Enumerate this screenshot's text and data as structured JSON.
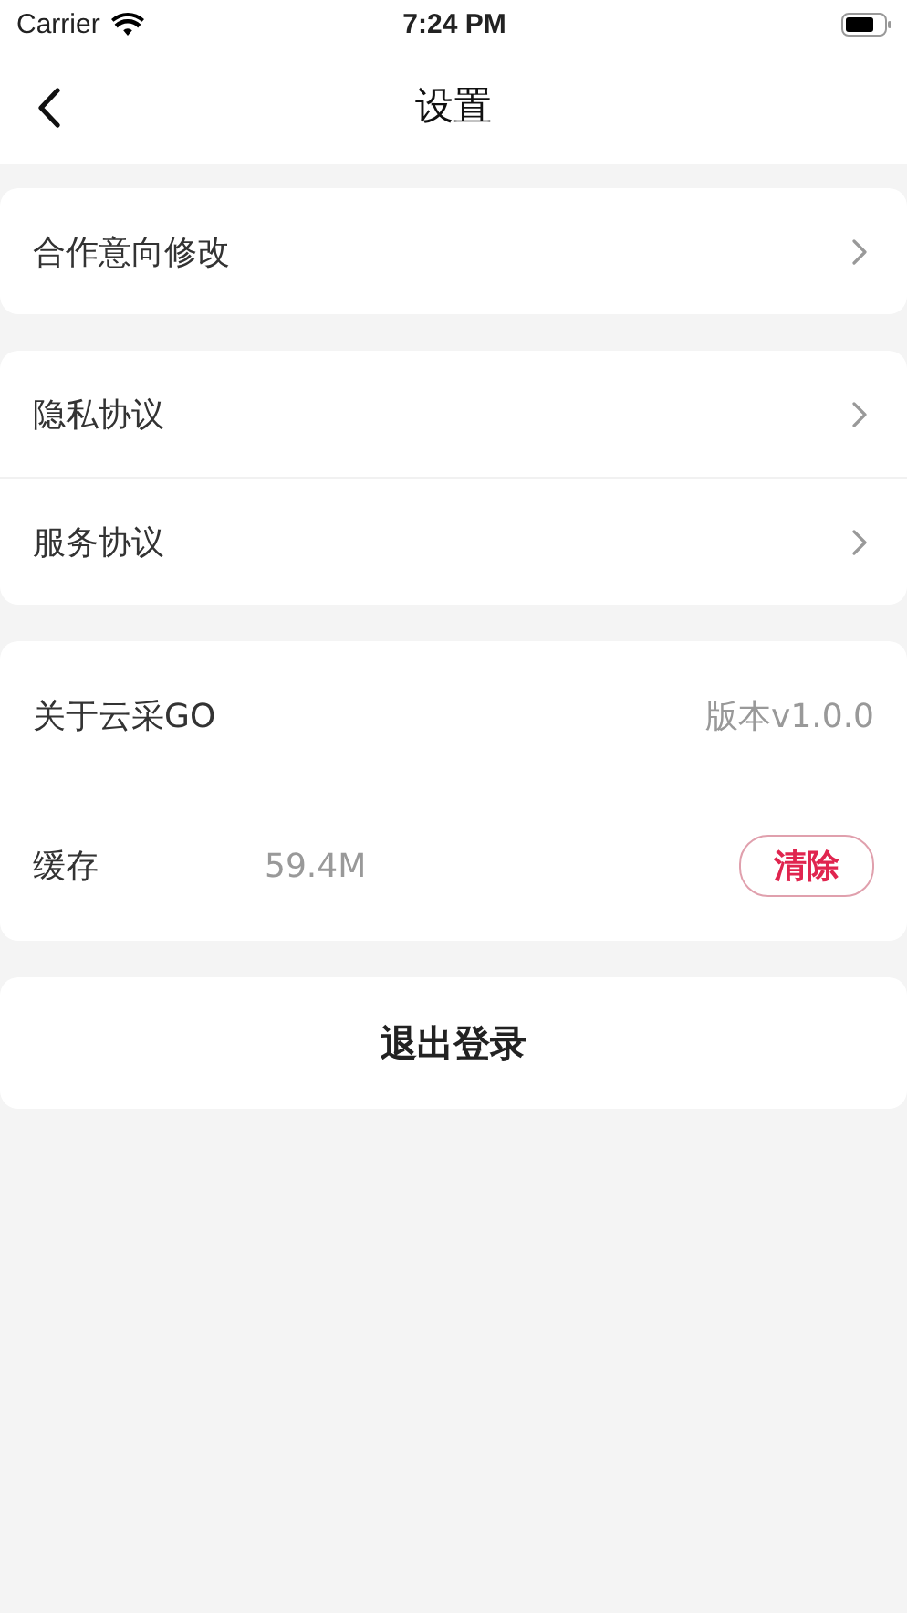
{
  "status_bar": {
    "carrier": "Carrier",
    "time": "7:24 PM"
  },
  "nav": {
    "title": "设置"
  },
  "groups": [
    {
      "rows": [
        {
          "kind": "link",
          "label": "合作意向修改"
        }
      ]
    },
    {
      "rows": [
        {
          "kind": "link",
          "label": "隐私协议"
        },
        {
          "kind": "link",
          "label": "服务协议"
        }
      ]
    },
    {
      "rows": [
        {
          "kind": "info",
          "label": "关于云采GO",
          "value": "版本v1.0.0"
        },
        {
          "kind": "cache",
          "label": "缓存",
          "value": "59.4M",
          "action": "清除"
        }
      ]
    }
  ],
  "logout": {
    "label": "退出登录"
  }
}
